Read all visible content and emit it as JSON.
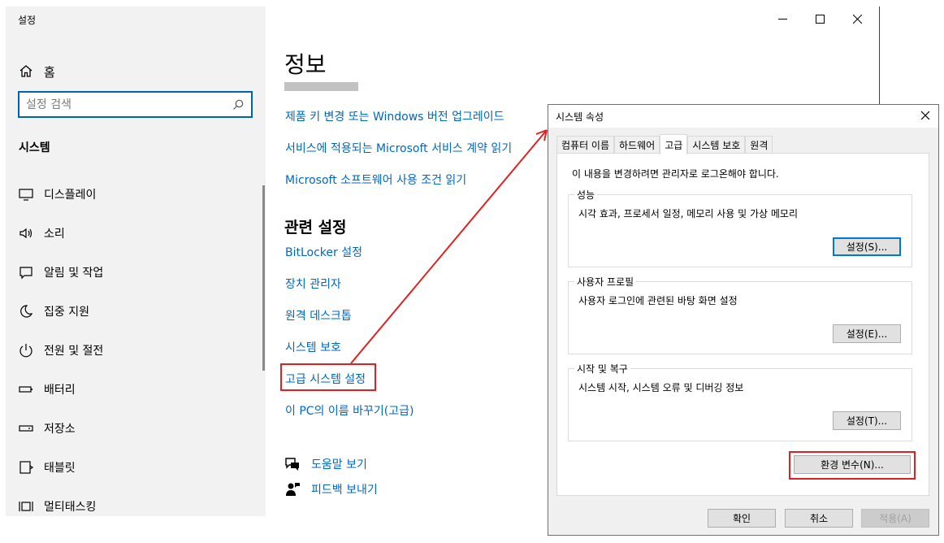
{
  "settings": {
    "app_title": "설정",
    "home_label": "홈",
    "search_placeholder": "설정 검색",
    "section_title": "시스템",
    "nav_items": [
      {
        "label": "디스플레이",
        "icon": "display-icon"
      },
      {
        "label": "소리",
        "icon": "sound-icon"
      },
      {
        "label": "알림 및 작업",
        "icon": "notification-icon"
      },
      {
        "label": "집중 지원",
        "icon": "moon-icon"
      },
      {
        "label": "전원 및 절전",
        "icon": "power-icon"
      },
      {
        "label": "배터리",
        "icon": "battery-icon"
      },
      {
        "label": "저장소",
        "icon": "storage-icon"
      },
      {
        "label": "태블릿",
        "icon": "tablet-icon"
      },
      {
        "label": "멀티태스킹",
        "icon": "multitasking-icon"
      }
    ],
    "page_title": "정보",
    "links": [
      "제품 키 변경 또는 Windows 버전 업그레이드",
      "서비스에 적용되는 Microsoft 서비스 계약 읽기",
      "Microsoft 소프트웨어 사용 조건 읽기"
    ],
    "related_heading": "관련 설정",
    "related_links": [
      "BitLocker 설정",
      "장치 관리자",
      "원격 데스크톱",
      "시스템 보호",
      "고급 시스템 설정",
      "이 PC의 이름 바꾸기(고급)"
    ],
    "help": {
      "get_help": "도움말 보기",
      "feedback": "피드백 보내기"
    }
  },
  "dialog": {
    "title": "시스템 속성",
    "tabs": [
      "컴퓨터 이름",
      "하드웨어",
      "고급",
      "시스템 보호",
      "원격"
    ],
    "active_tab": "고급",
    "admin_note": "이 내용을 변경하려면 관리자로 로그온해야 합니다.",
    "groups": [
      {
        "label": "성능",
        "desc": "시각 효과, 프로세서 일정, 메모리 사용 및 가상 메모리",
        "button": "설정(S)..."
      },
      {
        "label": "사용자 프로필",
        "desc": "사용자 로그인에 관련된 바탕 화면 설정",
        "button": "설정(E)..."
      },
      {
        "label": "시작 및 복구",
        "desc": "시스템 시작, 시스템 오류 및 디버깅 정보",
        "button": "설정(T)..."
      }
    ],
    "env_button": "환경 변수(N)...",
    "ok": "확인",
    "cancel": "취소",
    "apply": "적용(A)"
  },
  "colors": {
    "link": "#0067c0",
    "highlight": "#e02020",
    "focus": "#0078d7"
  }
}
